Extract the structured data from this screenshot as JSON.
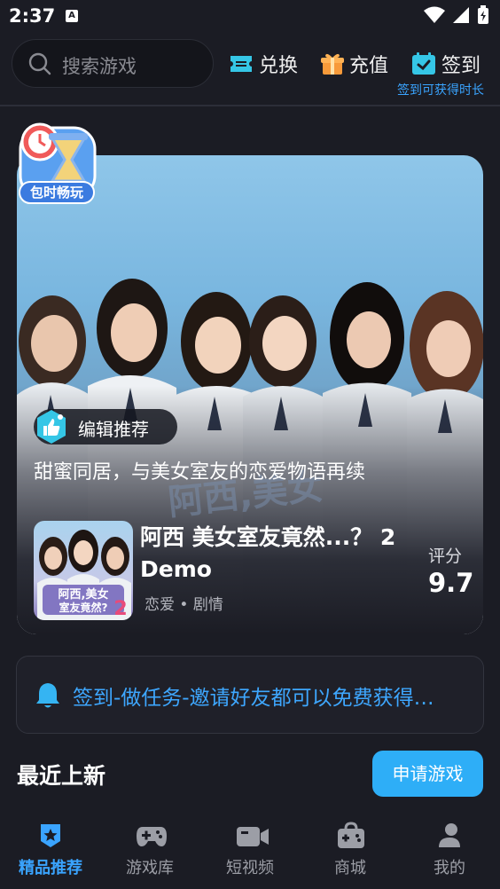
{
  "status": {
    "time": "2:37",
    "notif_glyph": "A"
  },
  "top": {
    "search_placeholder": "搜索游戏",
    "exchange_label": "兑换",
    "recharge_label": "充值",
    "signin_label": "签到",
    "signin_hint": "签到可获得时长"
  },
  "hero": {
    "badge_text": "包时畅玩",
    "watermark": "阿西,美女",
    "editor_label": "编辑推荐",
    "description": "甜蜜同居，与美女室友的恋爱物语再续",
    "game_title": "阿西 美女室友竟然...？ 2 Demo",
    "tags": "恋爱 • 剧情",
    "score_label": "评分",
    "score_value": "9.7",
    "thumb_text_1": "阿西,美女",
    "thumb_text_2": "室友竟然?"
  },
  "notice": {
    "text": "签到-做任务-邀请好友都可以免费获得…"
  },
  "section": {
    "title": "最近上新",
    "apply_button": "申请游戏"
  },
  "nav": {
    "items": [
      {
        "label": "精品推荐",
        "icon": "star-badge-icon",
        "active": true
      },
      {
        "label": "游戏库",
        "icon": "gamepad-icon",
        "active": false
      },
      {
        "label": "短视频",
        "icon": "video-camera-icon",
        "active": false
      },
      {
        "label": "商城",
        "icon": "shop-icon",
        "active": false
      },
      {
        "label": "我的",
        "icon": "profile-icon",
        "active": false
      }
    ]
  },
  "colors": {
    "background": "#1b1c24",
    "accent": "#3aa4ff",
    "button": "#2eaef7",
    "cyan": "#35c6e6"
  }
}
